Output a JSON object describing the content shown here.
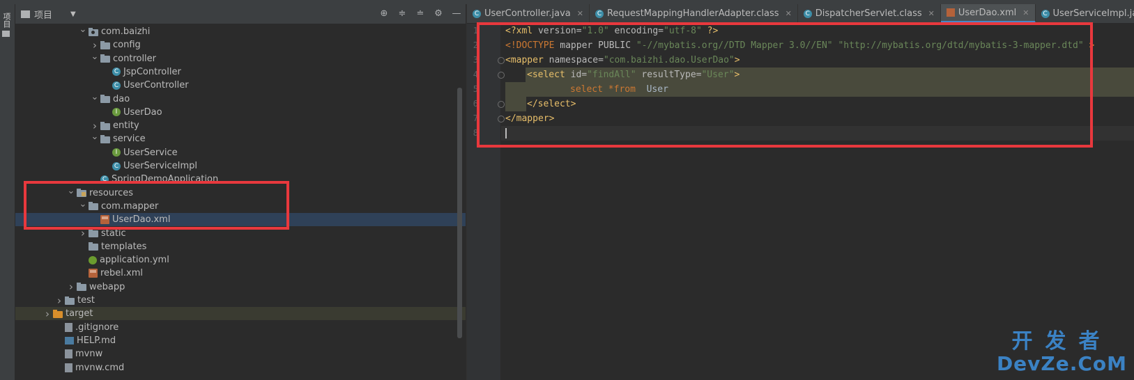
{
  "sidebar": {
    "tool_window_label": "项目"
  },
  "project_panel": {
    "title": "项目",
    "toolbar_icons": [
      "locate-icon",
      "expand-all-icon",
      "collapse-all-icon",
      "gear-icon",
      "minimize-icon"
    ],
    "tree": [
      {
        "label": "com.baizhi",
        "indent": 1,
        "arrow": "down",
        "icon": "package"
      },
      {
        "label": "config",
        "indent": 2,
        "arrow": "right",
        "icon": "folder"
      },
      {
        "label": "controller",
        "indent": 2,
        "arrow": "down",
        "icon": "folder"
      },
      {
        "label": "JspController",
        "indent": 3,
        "arrow": "",
        "icon": "class"
      },
      {
        "label": "UserController",
        "indent": 3,
        "arrow": "",
        "icon": "class"
      },
      {
        "label": "dao",
        "indent": 2,
        "arrow": "down",
        "icon": "folder"
      },
      {
        "label": "UserDao",
        "indent": 3,
        "arrow": "",
        "icon": "interface"
      },
      {
        "label": "entity",
        "indent": 2,
        "arrow": "right",
        "icon": "folder"
      },
      {
        "label": "service",
        "indent": 2,
        "arrow": "down",
        "icon": "folder"
      },
      {
        "label": "UserService",
        "indent": 3,
        "arrow": "",
        "icon": "interface"
      },
      {
        "label": "UserServiceImpl",
        "indent": 3,
        "arrow": "",
        "icon": "class"
      },
      {
        "label": "SpringDemoApplication",
        "indent": 2,
        "arrow": "",
        "icon": "class"
      },
      {
        "label": "resources",
        "indent": 0,
        "arrow": "down",
        "icon": "resources"
      },
      {
        "label": "com.mapper",
        "indent": 1,
        "arrow": "down",
        "icon": "folder"
      },
      {
        "label": "UserDao.xml",
        "indent": 2,
        "arrow": "",
        "icon": "xml",
        "selected": true
      },
      {
        "label": "static",
        "indent": 1,
        "arrow": "right",
        "icon": "folder"
      },
      {
        "label": "templates",
        "indent": 1,
        "arrow": "",
        "icon": "folder"
      },
      {
        "label": "application.yml",
        "indent": 1,
        "arrow": "",
        "icon": "yml"
      },
      {
        "label": "rebel.xml",
        "indent": 1,
        "arrow": "",
        "icon": "xml"
      },
      {
        "label": "webapp",
        "indent": 0,
        "arrow": "right",
        "icon": "folder"
      },
      {
        "label": "test",
        "indent": -1,
        "arrow": "right",
        "icon": "folder"
      },
      {
        "label": "target",
        "indent": -2,
        "arrow": "right",
        "icon": "folder-orange",
        "highlight": true
      },
      {
        "label": ".gitignore",
        "indent": -1,
        "arrow": "",
        "icon": "file"
      },
      {
        "label": "HELP.md",
        "indent": -1,
        "arrow": "",
        "icon": "md"
      },
      {
        "label": "mvnw",
        "indent": -1,
        "arrow": "",
        "icon": "file"
      },
      {
        "label": "mvnw.cmd",
        "indent": -1,
        "arrow": "",
        "icon": "file"
      }
    ]
  },
  "editor": {
    "tabs": [
      {
        "label": "UserController.java",
        "icon": "class",
        "active": false
      },
      {
        "label": "RequestMappingHandlerAdapter.class",
        "icon": "class",
        "active": false
      },
      {
        "label": "DispatcherServlet.class",
        "icon": "class",
        "active": false
      },
      {
        "label": "UserDao.xml",
        "icon": "xml",
        "active": true
      },
      {
        "label": "UserServiceImpl.java",
        "icon": "class",
        "active": false
      }
    ],
    "line_numbers": [
      "1",
      "2",
      "3",
      "4",
      "5",
      "6",
      "7",
      "8"
    ],
    "code": {
      "l1_a": "<?xml ",
      "l1_b": "version=",
      "l1_c": "\"1.0\"",
      "l1_d": " encoding=",
      "l1_e": "\"utf-8\"",
      "l1_f": " ?>",
      "l2_a": "<!DOCTYPE ",
      "l2_b": "mapper PUBLIC ",
      "l2_c": "\"-//mybatis.org//DTD Mapper 3.0//EN\"",
      "l2_d": " ",
      "l2_e": "\"http://mybatis.org/dtd/mybatis-3-mapper.dtd\"",
      "l2_f": " >",
      "l3_a": "<mapper ",
      "l3_b": "namespace=",
      "l3_c": "\"com.baizhi.dao.UserDao\"",
      "l3_d": ">",
      "l4_a": "<select ",
      "l4_b": "id=",
      "l4_c": "\"findAll\"",
      "l4_d": " resultType=",
      "l4_e": "\"User\"",
      "l4_f": ">",
      "l5_a": "select ",
      "l5_b": "*from",
      "l5_c": "  User",
      "l6_a": "</select>",
      "l7_a": "</mapper>"
    }
  },
  "watermark": {
    "cn": "开发者",
    "en": "DevZe.CoM"
  },
  "colors": {
    "annotation_red": "#e8383d",
    "selection_blue": "#2f4158",
    "tab_accent": "#4a88c7"
  }
}
